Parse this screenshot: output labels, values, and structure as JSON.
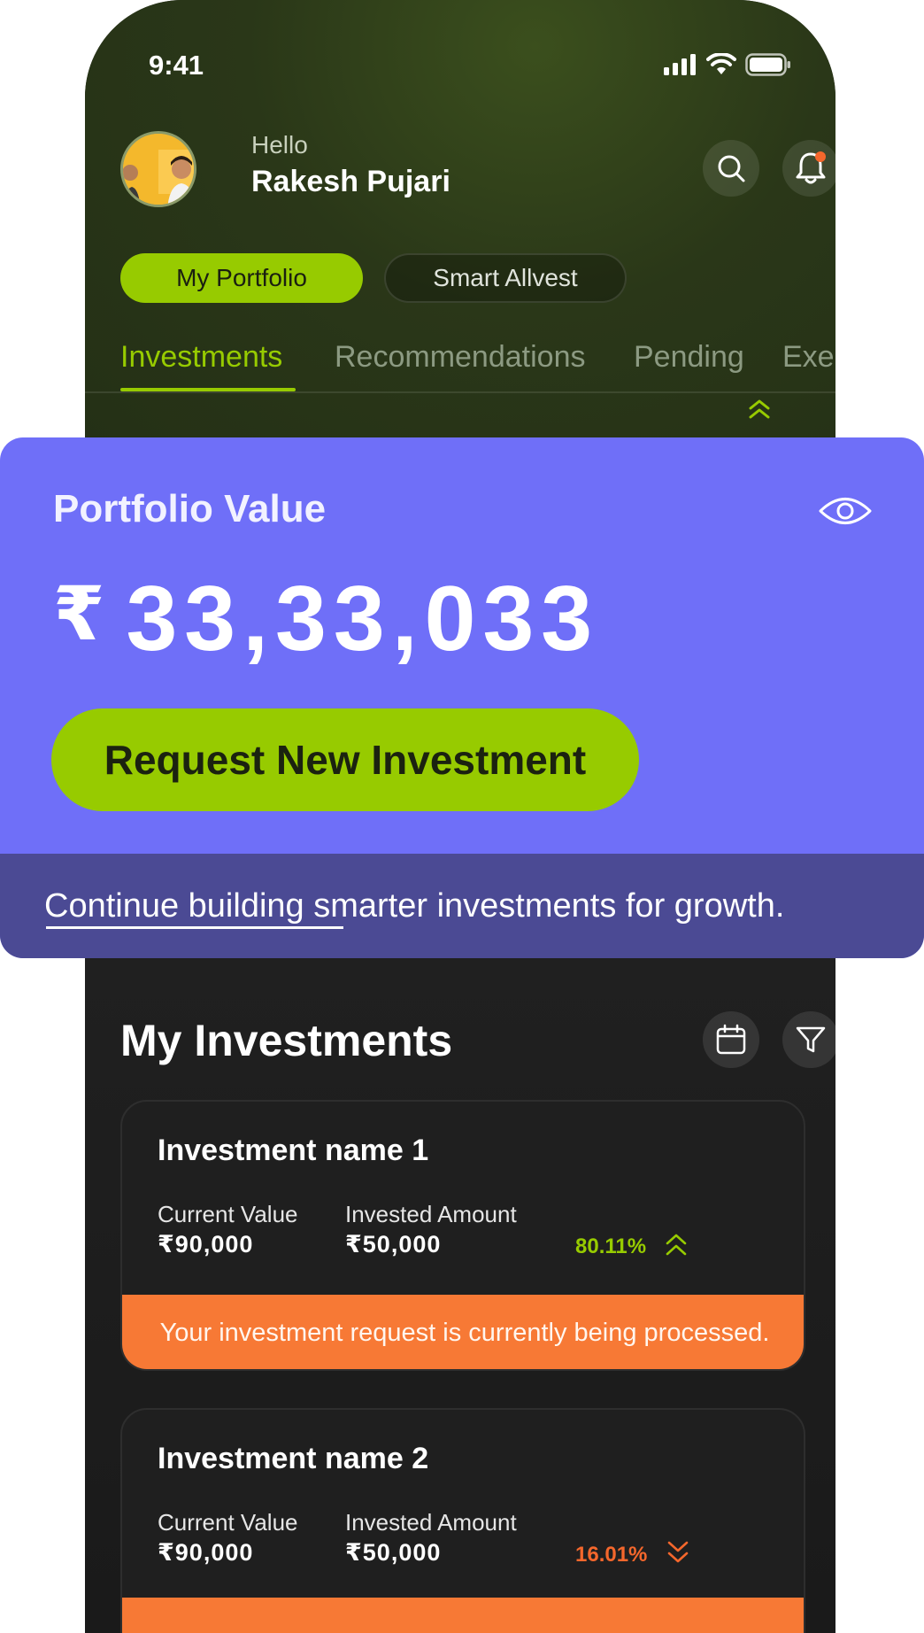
{
  "status_bar": {
    "time": "9:41"
  },
  "header": {
    "greeting": "Hello",
    "user_name": "Rakesh Pujari"
  },
  "segments": {
    "active": "My Portfolio",
    "inactive": "Smart Allvest"
  },
  "tabs": [
    {
      "label": "Investments",
      "active": true
    },
    {
      "label": "Recommendations",
      "active": false
    },
    {
      "label": "Pending",
      "active": false
    },
    {
      "label": "Executed",
      "active": false
    }
  ],
  "portfolio": {
    "title": "Portfolio Value",
    "currency": "₹",
    "value": "33,33,033",
    "cta_label": "Request New Investment",
    "tagline": "Continue building smarter investments for growth.",
    "tagline_underlined": "Continue building"
  },
  "my_investments": {
    "title": "My Investments",
    "items": [
      {
        "name": "Investment name 1",
        "current_value_label": "Current Value",
        "current_value": "₹90,000",
        "invested_label": "Invested Amount",
        "invested_amount": "₹50,000",
        "change": "80.11%",
        "trend": "up",
        "notice": "Your investment request is currently being processed."
      },
      {
        "name": "Investment name 2",
        "current_value_label": "Current Value",
        "current_value": "₹90,000",
        "invested_label": "Invested Amount",
        "invested_amount": "₹50,000",
        "change": "16.01%",
        "trend": "down",
        "notice": ""
      }
    ]
  },
  "colors": {
    "accent_green": "#97cb00",
    "card_purple": "#6f6ff8",
    "band_purple": "#4b4a94",
    "notice_orange": "#f77935",
    "down_red": "#f4672c",
    "notification_dot": "#f4672c"
  },
  "icons": [
    "search-icon",
    "bell-icon",
    "eye-icon",
    "calendar-icon",
    "filter-icon",
    "double-chevron-up-icon",
    "double-chevron-down-icon",
    "signal-icon",
    "wifi-icon",
    "battery-icon"
  ]
}
